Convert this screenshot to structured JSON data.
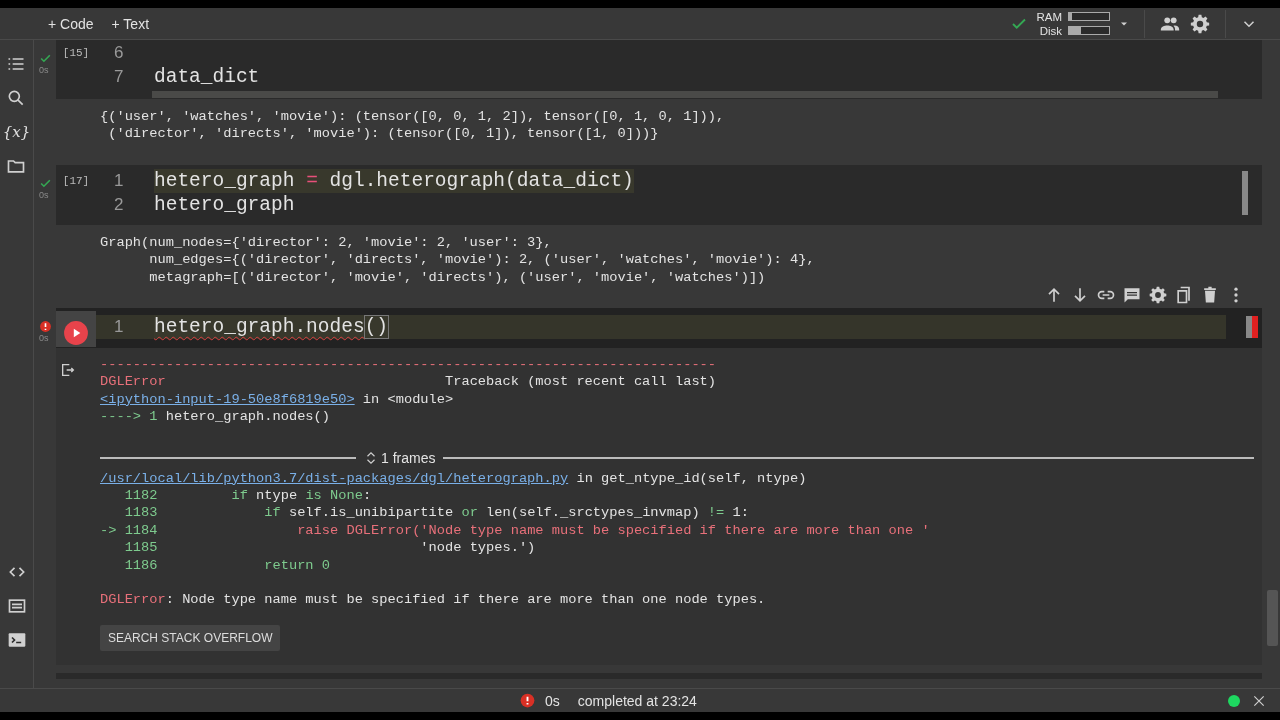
{
  "toolbar": {
    "buttons": [
      {
        "label": "+ Code"
      },
      {
        "label": "+ Text"
      }
    ]
  },
  "resources": {
    "connected": true,
    "meters": [
      {
        "label": "RAM",
        "level": 0.08
      },
      {
        "label": "Disk",
        "level": 0.3
      }
    ]
  },
  "sidebar": {
    "variables_label": "{x}"
  },
  "cells": [
    {
      "selected": false,
      "error": false,
      "exec_count": "[15]",
      "time": "0s",
      "lines": [
        {
          "num": "6"
        },
        {
          "num": "7",
          "segments": [
            {
              "text": "data_dict",
              "kind": "plain"
            }
          ]
        }
      ],
      "output": [
        {
          "lines": [
            [
              {
                "text": "{('user', 'watches', 'movie'): (tensor([0, 0, 1, 2]), tensor([0, 1, 0, 1])),",
                "kind": "plain"
              }
            ],
            [
              {
                "text": " ('director', 'directs', 'movie'): (tensor([0, 1]), tensor([1, 0]))}",
                "kind": "plain"
              }
            ]
          ]
        }
      ]
    },
    {
      "selected": false,
      "error": false,
      "exec_count": "[17]",
      "time": "0s",
      "lines": [
        {
          "num": "1",
          "segments": [
            {
              "text": "hetero_graph ",
              "kind": "plain"
            },
            {
              "text": "=",
              "kind": "op"
            },
            {
              "text": " dgl.heterograph(data_dict)",
              "kind": "plain"
            }
          ]
        },
        {
          "num": "2",
          "segments": [
            {
              "text": "hetero_graph",
              "kind": "plain"
            }
          ]
        }
      ],
      "output": [
        {
          "lines": [
            [
              {
                "text": "Graph(num_nodes={'director': 2, 'movie': 2, 'user': 3},",
                "kind": "plain"
              }
            ],
            [
              {
                "text": "      num_edges={('director', 'directs', 'movie'): 2, ('user', 'watches', 'movie'): 4},",
                "kind": "plain"
              }
            ],
            [
              {
                "text": "      metagraph=[('director', 'movie', 'directs'), ('user', 'movie', 'watches')])",
                "kind": "plain"
              }
            ]
          ]
        }
      ]
    },
    {
      "selected": true,
      "error": true,
      "time": "0s",
      "lines": [
        {
          "num": "1",
          "segments": [
            {
              "text": "hetero_graph.nodes",
              "kind": "squiggle"
            },
            {
              "text": "()",
              "kind": "match"
            }
          ]
        }
      ],
      "output": [
        {
          "lines": [
            [
              {
                "text": "---------------------------------------------------------------------------",
                "kind": "err"
              }
            ],
            [
              {
                "text": "DGLError",
                "kind": "err"
              },
              {
                "text": "                                  Traceback (most recent call last)",
                "kind": "plain"
              }
            ],
            [
              {
                "text": "<ipython-input-19-50e8f6819e50>",
                "kind": "link"
              },
              {
                "text": " in <module>",
                "kind": "plain"
              }
            ],
            [
              {
                "text": "----> 1 ",
                "kind": "ok"
              },
              {
                "text": "hetero_graph.nodes()",
                "kind": "plain"
              }
            ]
          ]
        },
        {
          "frames": "1 frames"
        },
        {
          "lines": [
            [
              {
                "text": "/usr/local/lib/python3.7/dist-packages/dgl/heterograph.py",
                "kind": "link"
              },
              {
                "text": " in get_ntype_id(self, ntype)",
                "kind": "plain"
              }
            ],
            [
              {
                "text": "   1182         if ",
                "kind": "ok"
              },
              {
                "text": "ntype ",
                "kind": "plain"
              },
              {
                "text": "is None",
                "kind": "ok"
              },
              {
                "text": ":",
                "kind": "plain"
              }
            ],
            [
              {
                "text": "   1183             if ",
                "kind": "ok"
              },
              {
                "text": "self.is_unibipartite ",
                "kind": "plain"
              },
              {
                "text": "or ",
                "kind": "ok"
              },
              {
                "text": "len(self._srctypes_invmap) ",
                "kind": "plain"
              },
              {
                "text": "!=",
                "kind": "ok"
              },
              {
                "text": " 1:",
                "kind": "plain"
              }
            ],
            [
              {
                "text": "-> 1184                 ",
                "kind": "ok"
              },
              {
                "text": "raise DGLError('Node type name must be specified if there are more than one '",
                "kind": "err"
              }
            ],
            [
              {
                "text": "   1185                                ",
                "kind": "ok"
              },
              {
                "text": "'node types.')",
                "kind": "plain"
              }
            ],
            [
              {
                "text": "   1186             return 0",
                "kind": "ok"
              }
            ]
          ]
        },
        {
          "lines": [
            [
              {
                "text": "DGLError",
                "kind": "err"
              },
              {
                "text": ": Node type name must be specified if there are more than one node types.",
                "kind": "plain"
              }
            ]
          ]
        }
      ],
      "action_button": "SEARCH STACK OVERFLOW"
    }
  ],
  "status_bar": {
    "error": true,
    "duration": "0s",
    "message": "completed at 23:24",
    "connected": true
  }
}
